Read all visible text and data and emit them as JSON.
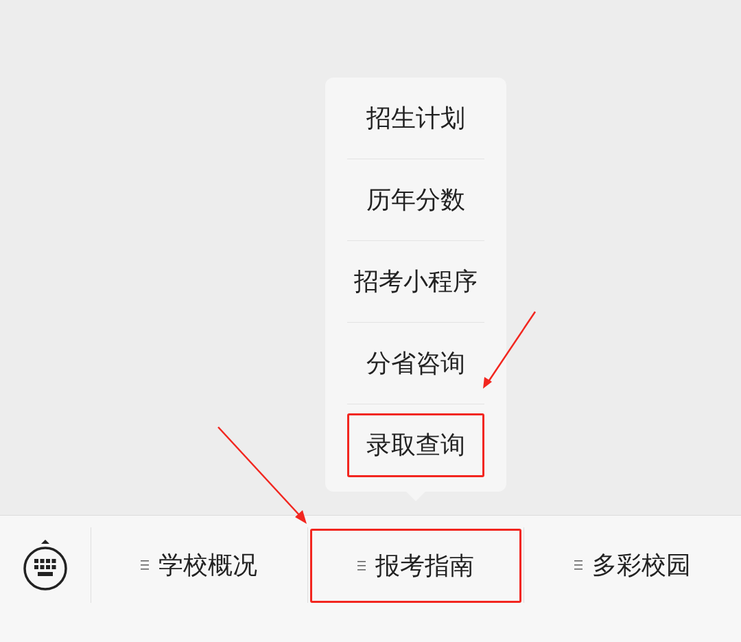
{
  "popup_menu": {
    "items": [
      {
        "label": "招生计划",
        "highlighted": false
      },
      {
        "label": "历年分数",
        "highlighted": false
      },
      {
        "label": "招考小程序",
        "highlighted": false
      },
      {
        "label": "分省咨询",
        "highlighted": false
      },
      {
        "label": "录取查询",
        "highlighted": true
      }
    ]
  },
  "bottom_menu": {
    "tabs": [
      {
        "label": "学校概况",
        "highlighted": false
      },
      {
        "label": "报考指南",
        "highlighted": true
      },
      {
        "label": "多彩校园",
        "highlighted": false
      }
    ]
  }
}
